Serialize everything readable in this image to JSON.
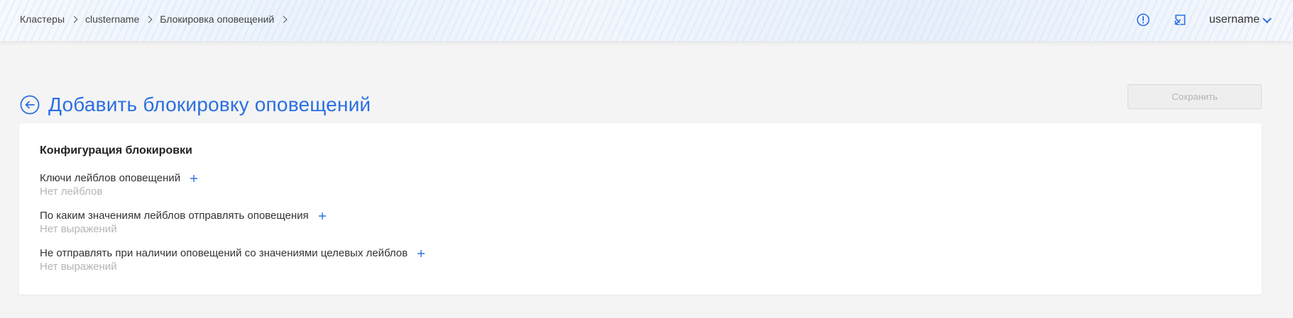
{
  "breadcrumb": {
    "items": [
      "Кластеры",
      "clustername",
      "Блокировка оповещений"
    ]
  },
  "header": {
    "username": "username",
    "icons": [
      "alert-circle-icon",
      "external-link-icon"
    ]
  },
  "page": {
    "title": "Добавить блокировку оповещений",
    "save_label": "Сохранить"
  },
  "config": {
    "title": "Конфигурация блокировки",
    "fields": [
      {
        "label": "Ключи лейблов оповещений",
        "empty": "Нет лейблов"
      },
      {
        "label": "По каким значениям лейблов отправлять оповещения",
        "empty": "Нет выражений"
      },
      {
        "label": "Не отправлять при наличии оповещений со значениями целевых лейблов",
        "empty": "Нет выражений"
      }
    ]
  },
  "colors": {
    "accent": "#2b6fe0",
    "muted": "#b5b5b5",
    "background": "#f4f4f4"
  }
}
